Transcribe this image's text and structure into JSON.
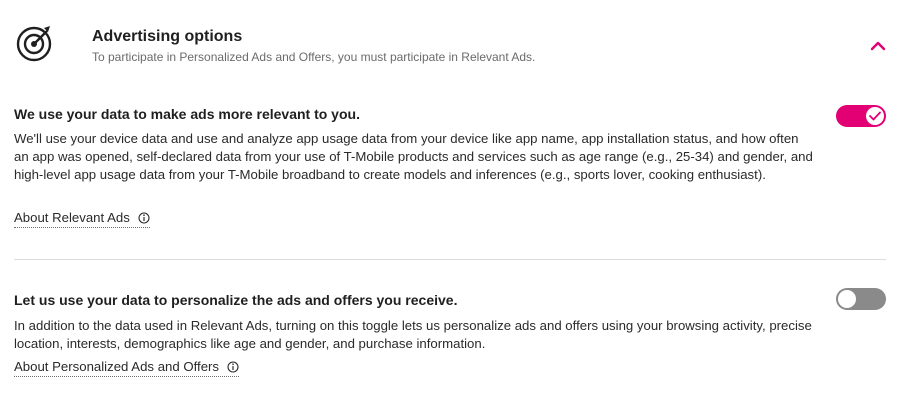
{
  "header": {
    "title": "Advertising options",
    "subtitle": "To participate in Personalized Ads and Offers, you must participate in Relevant Ads.",
    "icon": "target-icon",
    "collapse_icon": "chevron-up-icon"
  },
  "relevant_ads": {
    "title": "We use your data to make ads more relevant to you.",
    "body": "We'll use your device data and use and analyze app usage data from your device like app name, app installation status, and how often an app was opened, self-declared data from your use of T-Mobile products and services such as age range (e.g., 25-34) and gender, and high-level app usage data from your T-Mobile broadband to create models and inferences (e.g., sports lover, cooking enthusiast).",
    "link_label": "About Relevant Ads",
    "toggle_on": true
  },
  "personalized_ads": {
    "title": "Let us use your data to personalize the ads and offers you receive.",
    "body": "In addition to the data used in Relevant Ads, turning on this toggle lets us personalize ads and offers using your browsing activity, precise location, interests, demographics like age and gender, and purchase information.",
    "link_label": "About Personalized Ads and Offers",
    "toggle_on": false
  },
  "colors": {
    "accent": "#e20074",
    "toggle_off": "#8a8a8a"
  }
}
